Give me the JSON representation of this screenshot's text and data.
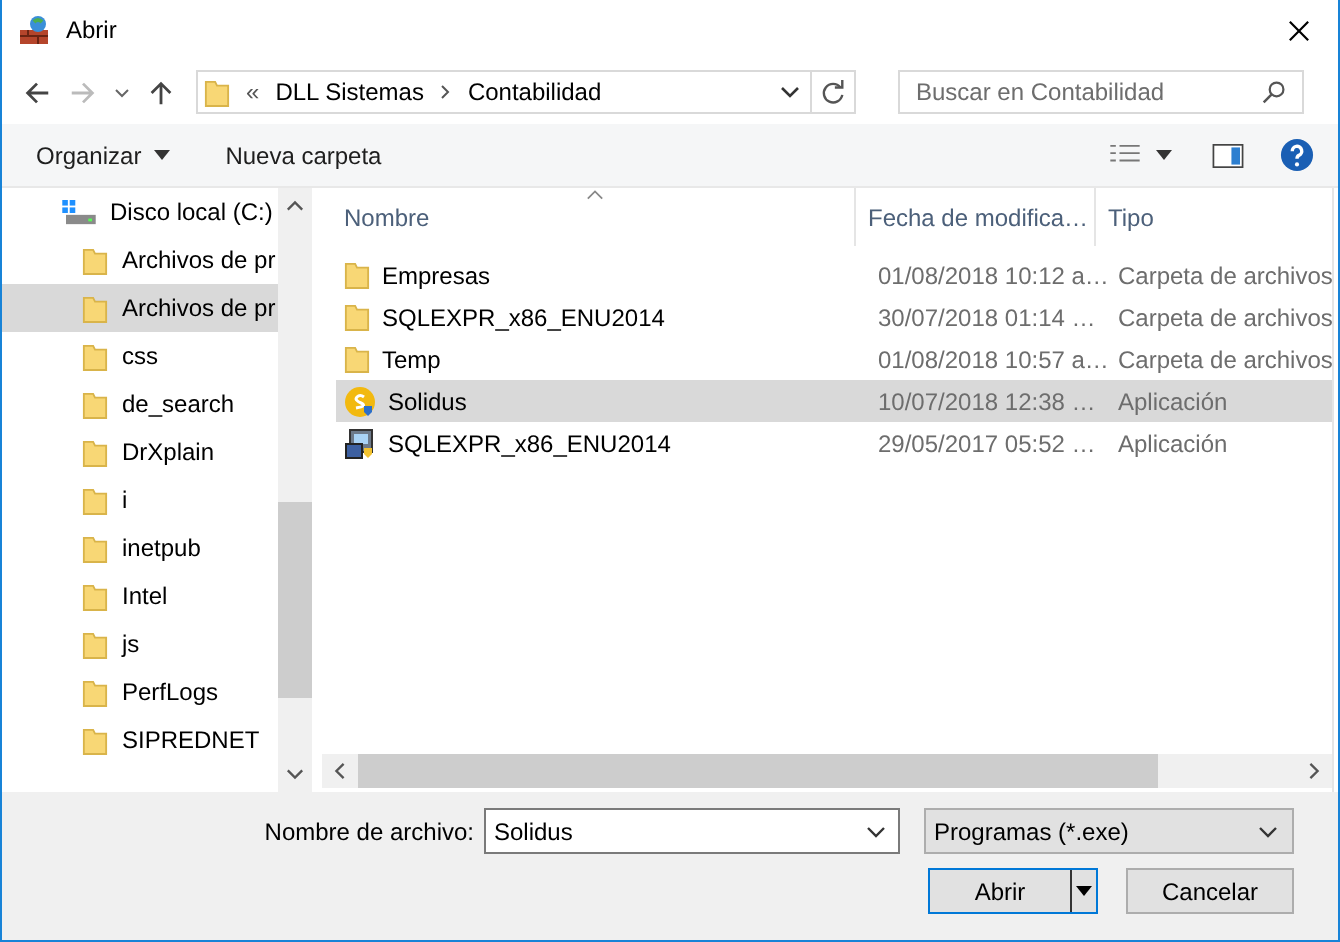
{
  "window": {
    "title": "Abrir"
  },
  "nav": {
    "overflow": "«",
    "path": [
      "DLL Sistemas",
      "Contabilidad"
    ],
    "search": {
      "placeholder": "Buscar en Contabilidad"
    }
  },
  "toolbar": {
    "organize": "Organizar",
    "new_folder": "Nueva carpeta"
  },
  "sidebar": {
    "items": [
      {
        "label": "Disco local (C:)",
        "kind": "drive",
        "selected": false,
        "children": [
          {
            "label": "Archivos de pr",
            "kind": "folder",
            "selected": false
          },
          {
            "label": "Archivos de pr",
            "kind": "folder",
            "selected": true
          },
          {
            "label": "css",
            "kind": "folder",
            "selected": false
          },
          {
            "label": "de_search",
            "kind": "folder",
            "selected": false
          },
          {
            "label": "DrXplain",
            "kind": "folder",
            "selected": false
          },
          {
            "label": "i",
            "kind": "folder",
            "selected": false
          },
          {
            "label": "inetpub",
            "kind": "folder",
            "selected": false
          },
          {
            "label": "Intel",
            "kind": "folder",
            "selected": false
          },
          {
            "label": "js",
            "kind": "folder",
            "selected": false
          },
          {
            "label": "PerfLogs",
            "kind": "folder",
            "selected": false
          },
          {
            "label": "SIPREDNET",
            "kind": "folder",
            "selected": false
          }
        ]
      }
    ]
  },
  "file_list": {
    "columns": [
      "Nombre",
      "Fecha de modifica…",
      "Tipo"
    ],
    "rows": [
      {
        "name": "Empresas",
        "date": "01/08/2018 10:12 a…",
        "type": "Carpeta de archivos",
        "kind": "folder",
        "selected": false
      },
      {
        "name": "SQLEXPR_x86_ENU2014",
        "date": "30/07/2018 01:14 …",
        "type": "Carpeta de archivos",
        "kind": "folder",
        "selected": false
      },
      {
        "name": "Temp",
        "date": "01/08/2018 10:57 a…",
        "type": "Carpeta de archivos",
        "kind": "folder",
        "selected": false
      },
      {
        "name": "Solidus",
        "date": "10/07/2018 12:38 …",
        "type": "Aplicación",
        "kind": "app",
        "selected": true
      },
      {
        "name": "SQLEXPR_x86_ENU2014",
        "date": "29/05/2017 05:52 …",
        "type": "Aplicación",
        "kind": "installer",
        "selected": false
      }
    ]
  },
  "footer": {
    "filename_label": "Nombre de archivo:",
    "filename": "Solidus",
    "filter": "Programas (*.exe)",
    "open": "Abrir",
    "cancel": "Cancelar"
  }
}
